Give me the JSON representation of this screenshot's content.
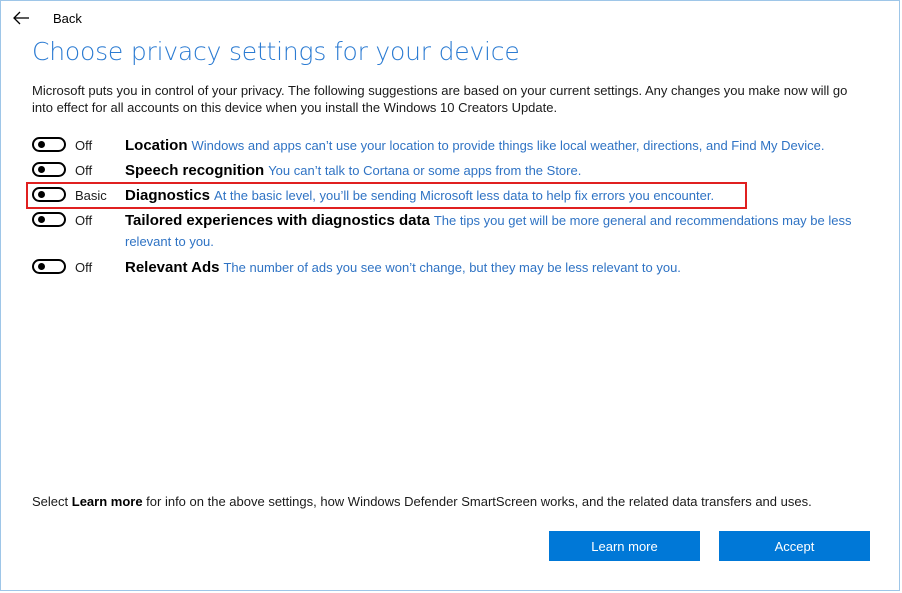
{
  "header": {
    "back_label": "Back",
    "back_icon": "arrow-left-icon"
  },
  "page": {
    "title": "Choose privacy settings for your device",
    "intro": "Microsoft puts you in control of your privacy. The following suggestions are based on your current settings. Any changes you make now will go into effect for all accounts on this device when you install the Windows 10 Creators Update."
  },
  "settings": [
    {
      "state": "Off",
      "title": "Location",
      "description": "Windows and apps can’t use your location to provide things like local weather, directions, and Find My Device."
    },
    {
      "state": "Off",
      "title": "Speech recognition",
      "description": "You can’t talk to Cortana or some apps from the Store."
    },
    {
      "state": "Basic",
      "title": "Diagnostics",
      "description": "At the basic level, you’ll be sending Microsoft less data to help fix errors you encounter."
    },
    {
      "state": "Off",
      "title": "Tailored experiences with diagnostics data",
      "description": "The tips you get will be more general and recommendations may be less relevant to you."
    },
    {
      "state": "Off",
      "title": "Relevant Ads",
      "description": "The number of ads you see won’t change, but they may be less relevant to you."
    }
  ],
  "footer": {
    "prefix": "Select ",
    "bold": "Learn more",
    "suffix": " for info on the above settings, how Windows Defender SmartScreen works, and the related data transfers and uses."
  },
  "buttons": {
    "learn_more": "Learn more",
    "accept": "Accept"
  },
  "colors": {
    "accent": "#0078d7",
    "title_blue": "#2b7bd2",
    "description_blue": "#2f73c4",
    "highlight_red": "#e02020"
  }
}
